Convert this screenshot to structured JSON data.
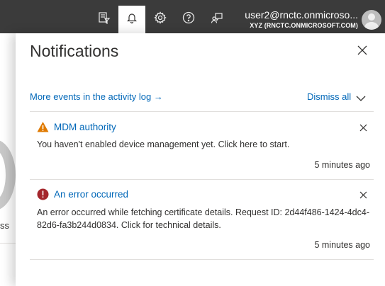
{
  "header": {
    "account_name": "user2@rnctc.onmicroso...",
    "account_tenant": "XYZ (RNCTC.ONMICROSOFT.COM)",
    "icons": [
      "feedback-hub-icon",
      "bell-icon",
      "gear-icon",
      "help-icon",
      "feedback-icon"
    ]
  },
  "background_page": {
    "partial_text": "ss"
  },
  "panel": {
    "title": "Notifications",
    "activity_link": "More events in the activity log →",
    "dismiss_all": "Dismiss all"
  },
  "notifications": [
    {
      "severity": "warning",
      "title": "MDM authority",
      "body": "You haven't enabled device management yet. Click here to start.",
      "time": "5 minutes ago"
    },
    {
      "severity": "error",
      "title": "An error occurred",
      "body": "An error occurred while fetching certificate details. Request ID: 2d44f486-1424-4dc4-82d6-fa3b244d0834. Click for technical details.",
      "time": "5 minutes ago"
    }
  ],
  "colors": {
    "header_bg": "#3b3b3b",
    "link": "#0067b8",
    "warning": "#e07a00",
    "error": "#a4262c"
  }
}
